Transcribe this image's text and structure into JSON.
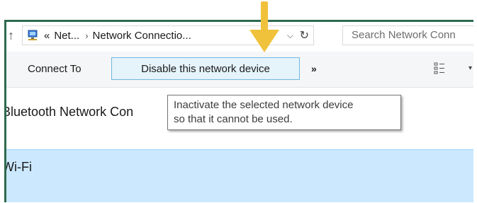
{
  "address_bar": {
    "back_chevrons": "«",
    "crumb_1": "Net...",
    "separator": "›",
    "crumb_2": "Network Connectio...",
    "dropdown_icon": "chevron-down-icon",
    "refresh_icon": "refresh-icon",
    "search_placeholder": "Search Network Conn"
  },
  "toolbar": {
    "connect_to": "Connect To",
    "disable_device": "Disable this network device",
    "more": "»",
    "view_icon": "view-options-icon"
  },
  "list": {
    "items": [
      {
        "label": "Bluetooth Network Con",
        "selected": false
      },
      {
        "label": "Wi-Fi",
        "selected": true
      }
    ]
  },
  "tooltip": {
    "line_1": "Inactivate the selected network device",
    "line_2": "so that it cannot be used."
  },
  "colors": {
    "frame_border": "#2d6a4f",
    "button_highlight": "#e5f3fb",
    "button_border": "#70b8e0",
    "selection": "#cce8ff",
    "callout_arrow": "#f0c23b"
  }
}
